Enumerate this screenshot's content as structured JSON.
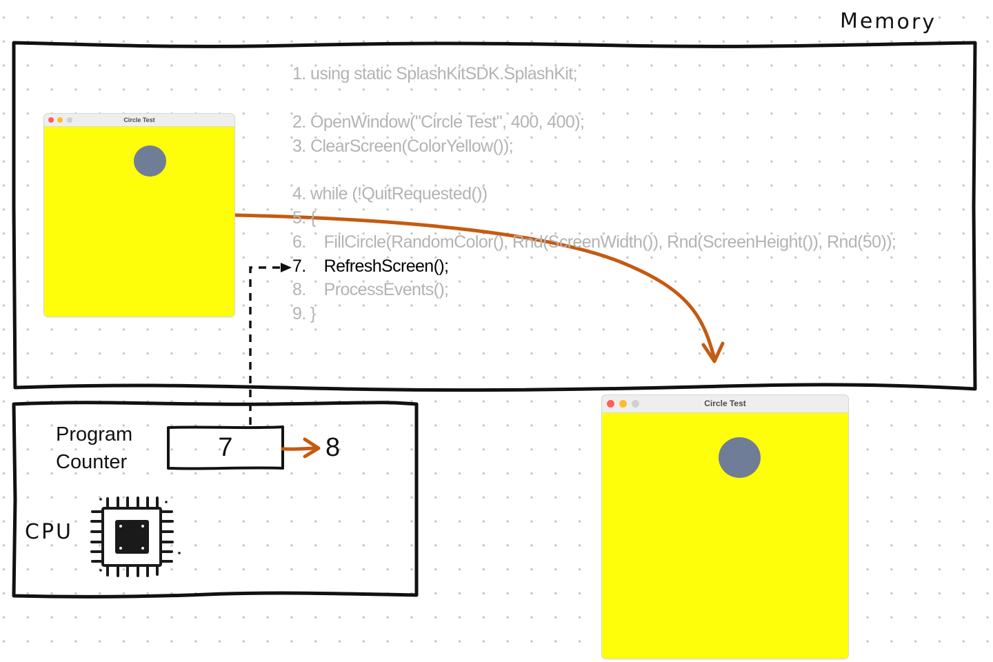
{
  "memory": {
    "title": "Memory",
    "code_lines": [
      {
        "num": "1.",
        "text": "using static SplashKitSDK.SplashKit;",
        "indented": false,
        "current": false
      },
      {
        "num": "2.",
        "text": "OpenWindow(\"Circle Test\", 400, 400);",
        "indented": false,
        "current": false
      },
      {
        "num": "3.",
        "text": "ClearScreen(ColorYellow());",
        "indented": false,
        "current": false
      },
      {
        "num": "4.",
        "text": "while (!QuitRequested())",
        "indented": false,
        "current": false
      },
      {
        "num": "5.",
        "text": "{",
        "indented": false,
        "current": false
      },
      {
        "num": "6.",
        "text": "FillCircle(RandomColor(), Rnd(ScreenWidth()), Rnd(ScreenHeight()), Rnd(50));",
        "indented": true,
        "current": false
      },
      {
        "num": "7.",
        "text": "RefreshScreen();",
        "indented": true,
        "current": true
      },
      {
        "num": "8.",
        "text": "ProcessEvents();",
        "indented": true,
        "current": false
      },
      {
        "num": "9.",
        "text": "}",
        "indented": false,
        "current": false
      }
    ],
    "back_buffer_window": {
      "title": "Circle Test"
    }
  },
  "cpu": {
    "title": "CPU",
    "program_counter": {
      "label_line1": "Program",
      "label_line2": "Counter",
      "value": "7",
      "next_value": "8"
    },
    "chip_icon": "cpu-chip-icon"
  },
  "screen_window": {
    "title": "Circle Test"
  },
  "colors": {
    "accent_arrow": "#c55a11",
    "window_background": "#fffe0a",
    "circle_fill": "#6f7d96",
    "code_inactive": "#b3b3b3",
    "code_active": "#000000",
    "outline": "#111111"
  }
}
